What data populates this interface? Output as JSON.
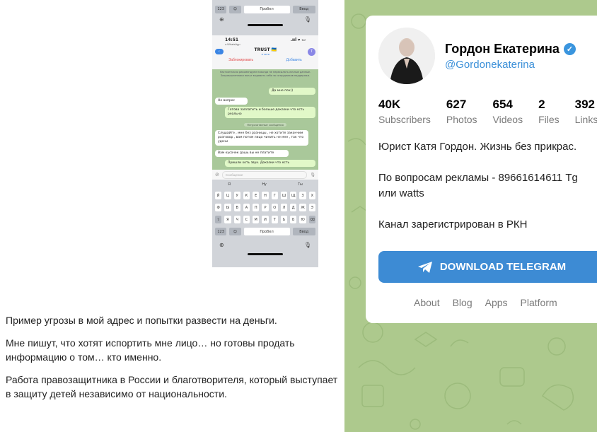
{
  "phone": {
    "top_keyboard": {
      "num_key": "123",
      "space": "Пробел",
      "enter": "Ввод"
    },
    "status_time": "14:51",
    "status_app": "◂ WhatsApp",
    "back_label": "",
    "chat_title": "TRUST 🇺🇦",
    "chat_subtitle": "в сети",
    "avatar_letter": "T",
    "action_block": "Заблокировать",
    "action_add": "Добавить",
    "notice_1": "Настоятельно рекомендуем никогда не пересылать личные данные.",
    "notice_2": "Злоумышленники могут выдавать себя за сотрудников поддержки.",
    "messages": [
      {
        "dir": "out",
        "text": "Да мне пох))"
      },
      {
        "dir": "in",
        "text": "Не вопрос"
      },
      {
        "dir": "out",
        "text": "Готова заплатить и больше доказки что есть реально"
      },
      {
        "dir": "sys",
        "text": "Непрочитанные сообщения"
      },
      {
        "dir": "in",
        "text": "Слушайте , мне без разницы , не хотите закончим разговор , вам потом лицо чинить не мне , так что удачи"
      },
      {
        "dir": "in",
        "text": "Вам кусочек дашь вы не платите"
      },
      {
        "dir": "out",
        "text": "Пришли хоть звук. Доказки что есть"
      }
    ],
    "composer_placeholder": "Сообщение",
    "suggestions": [
      "Я",
      "Ну",
      "Ты"
    ],
    "keyboard_rows": [
      [
        "Й",
        "Ц",
        "У",
        "К",
        "Е",
        "Н",
        "Г",
        "Ш",
        "Щ",
        "З",
        "Х"
      ],
      [
        "Ф",
        "Ы",
        "В",
        "А",
        "П",
        "Р",
        "О",
        "Л",
        "Д",
        "Ж",
        "Э"
      ],
      [
        "⇧",
        "Я",
        "Ч",
        "С",
        "М",
        "И",
        "Т",
        "Ь",
        "Б",
        "Ю",
        "⌫"
      ]
    ],
    "bottom_row": {
      "num_key": "123",
      "space": "Пробел",
      "enter": "Ввод"
    }
  },
  "article": {
    "p1": "Пример угрозы в мой адрес и попытки развести на деньги.",
    "p2": "Мне пишут, что хотят испортить мне лицо… но готовы продать информацию о том… кто именно.",
    "p3": "Работа правозащитника в России и благотворителя, который выступает в защиту детей независимо от национальности."
  },
  "telegram": {
    "name": "Гордон Екатерина",
    "handle": "@Gordonekaterina",
    "stats": [
      {
        "value": "40K",
        "label": "Subscribers"
      },
      {
        "value": "627",
        "label": "Photos"
      },
      {
        "value": "654",
        "label": "Videos"
      },
      {
        "value": "2",
        "label": "Files"
      },
      {
        "value": "392",
        "label": "Links"
      }
    ],
    "description": [
      "Юрист Катя Гордон. Жизнь без прикрас.",
      "По вопросам рекламы - 89661614611 Tg или watts",
      "Канал зарегистрирован в РКН"
    ],
    "download_label": "DOWNLOAD TELEGRAM",
    "footer": [
      "About",
      "Blog",
      "Apps",
      "Platform"
    ],
    "colors": {
      "background": "#adc98d",
      "button": "#3d8bd4",
      "link": "#3a8fd8"
    }
  }
}
